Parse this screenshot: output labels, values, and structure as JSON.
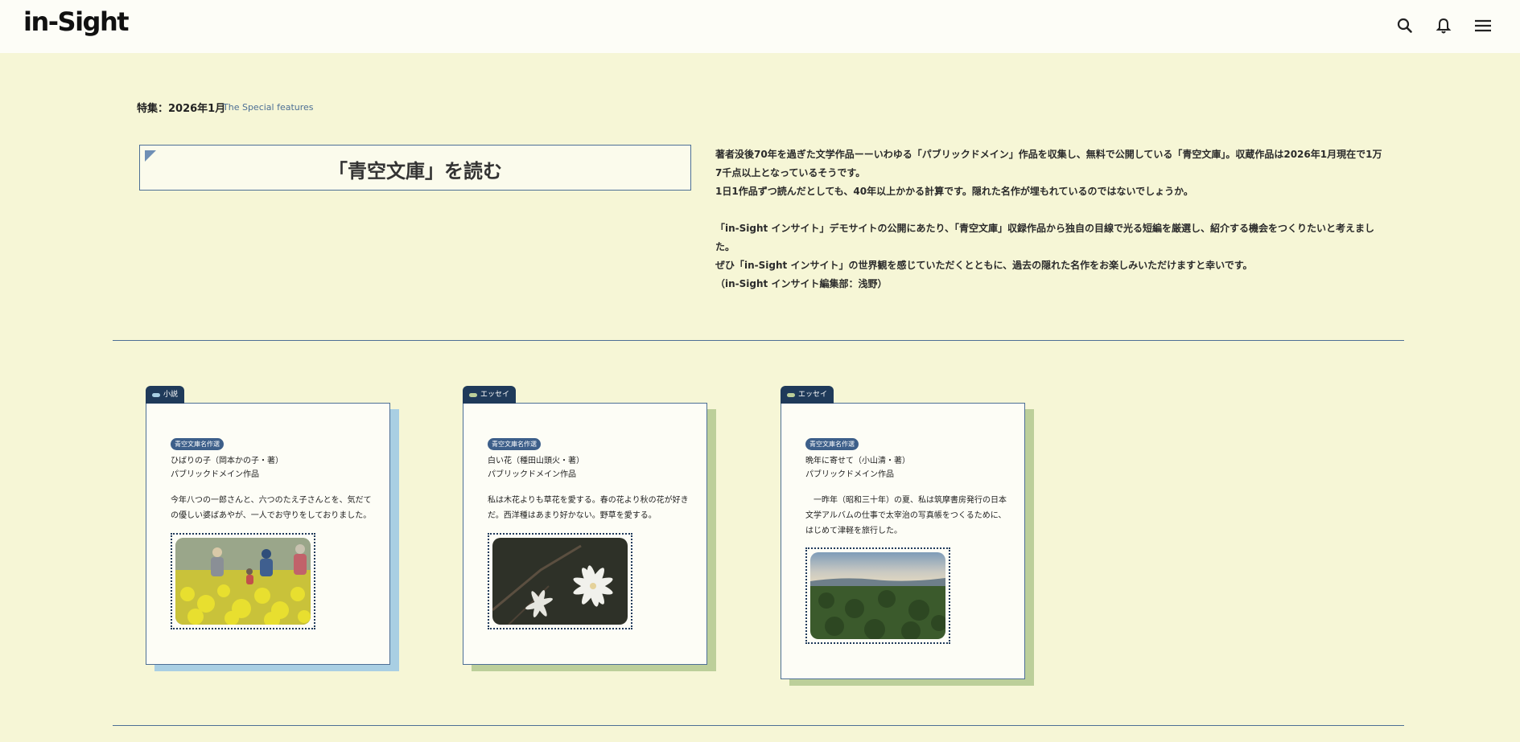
{
  "header": {
    "logo": "in-Sight",
    "icons": [
      "search-icon",
      "bell-icon",
      "menu-icon"
    ]
  },
  "feature": {
    "label": "特集：2026年1月",
    "sub": "The Special features",
    "title": "「青空文庫」を読む",
    "intro": [
      "著者没後70年を過ぎた文学作品ーーいわゆる「パブリックドメイン」作品を収集し、無料で公開している「青空文庫」。収蔵作品は2026年1月現在で1万7千点以上となっているそうです。",
      "1日1作品ずつ読んだとしても、40年以上かかる計算です。隠れた名作が埋もれているのではないでしょうか。",
      "「in-Sight インサイト」デモサイトの公開にあたり、「青空文庫」収録作品から独自の目線で光る短編を厳選し、紹介する機会をつくりたいと考えました。",
      "ぜひ「in-Sight インサイト」の世界観を感じていただくとともに、過去の隠れた名作をお楽しみいただけますと幸いです。",
      "（in-Sight インサイト編集部：浅野）"
    ]
  },
  "colors": {
    "background": "#f6f6d6",
    "header": "#fdfdf7",
    "accent": "#4d6f95",
    "tab": "#1f3a5a",
    "shadow_blue": "#a9cfe3",
    "shadow_green": "#bccf9a"
  },
  "cards": [
    {
      "tab": "小説",
      "pill_color": "#a9cfe3",
      "shadow_color": "#a9cfe3",
      "badge": "青空文庫名作選",
      "title": "ひばりの子（岡本かの子・著）",
      "subtitle": "パブリックドメイン作品",
      "desc": "今年八つの一郎さんと、六つのたえ子さんとを、気だての優しい婆ばあやが、一人でお守りをしておりました。",
      "image": "rapeseed-field-photo"
    },
    {
      "tab": "エッセイ",
      "pill_color": "#bccf9a",
      "shadow_color": "#bccf9a",
      "badge": "青空文庫名作選",
      "title": "白い花（種田山頭火・著）",
      "subtitle": "パブリックドメイン作品",
      "desc": "私は木花よりも草花を愛する。春の花より秋の花が好きだ。西洋種はあまり好かない。野草を愛する。",
      "image": "white-magnolia-photo"
    },
    {
      "tab": "エッセイ",
      "pill_color": "#bccf9a",
      "shadow_color": "#bccf9a",
      "badge": "青空文庫名作選",
      "title": "晩年に寄せて（小山清・著）",
      "subtitle": "パブリックドメイン作品",
      "desc": "　一昨年（昭和三十年）の夏、私は筑摩書房発行の日本文学アルバムの仕事で太宰治の写真帳をつくるために、はじめて津軽を旅行した。",
      "image": "forest-landscape-photo"
    }
  ]
}
